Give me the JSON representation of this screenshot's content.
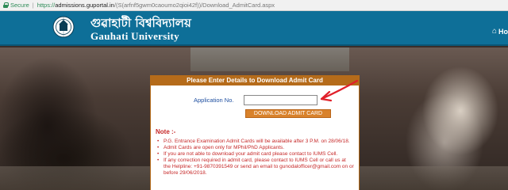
{
  "browser": {
    "secure_label": "Secure",
    "separator": "|",
    "url_scheme": "https://",
    "url_host": "admissions.guportal.in",
    "url_path": "/(S(arfnf5gwm0caoumo2qioi42f))/Download_AdmitCard.aspx"
  },
  "header": {
    "title_bengali": "গুৱাহাটী বিশ্ববিদ্যালয়",
    "title_english": "Gauhati University",
    "home_label": "Hom",
    "logo_icon": "university-seal-icon"
  },
  "form": {
    "heading": "Please Enter Details to Download Admit Card",
    "application_label": "Application No.",
    "application_value": "",
    "download_button": "DOWNLOAD ADMIT CARD"
  },
  "notes": {
    "heading": "Note :-",
    "items": [
      "P.G. Entrance Examination Admit Cards will be available after 3 P.M. on 28/06/18.",
      "Admit Cards are open only for MPhil/PhD Applicants.",
      "If you are not able to download your admit card please contact to IUMS Cell.",
      "If any correction required in admit card, please contact to IUMS Cell or call us at the Helpline: +91-9870391549 or send an email to gunodalofficer@gmail.com on or before 29/06/2018."
    ]
  },
  "colors": {
    "header_bg": "#0e6f98",
    "panel_accent": "#b56b1a",
    "button_bg": "#d9822b",
    "note_text": "#c62828",
    "annotation_arrow": "#e0202a"
  }
}
